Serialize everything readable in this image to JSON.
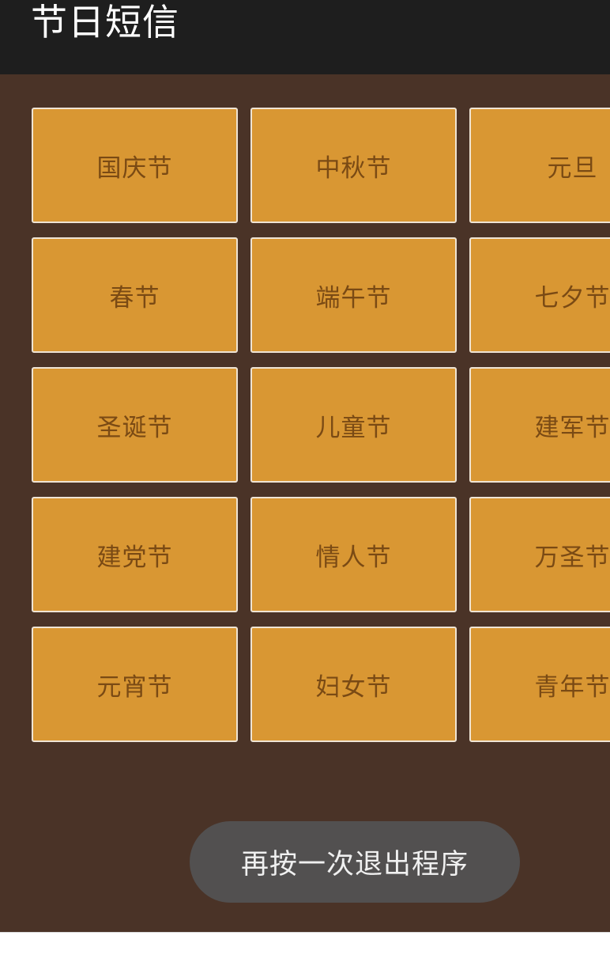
{
  "header": {
    "title": "节日短信"
  },
  "festivals": [
    "国庆节",
    "中秋节",
    "元旦",
    "春节",
    "端午节",
    "七夕节",
    "圣诞节",
    "儿童节",
    "建军节",
    "建党节",
    "情人节",
    "万圣节",
    "元宵节",
    "妇女节",
    "青年节"
  ],
  "toast": {
    "message": "再按一次退出程序"
  },
  "colors": {
    "background": "#4a3327",
    "header": "#1e1e1e",
    "tile": "#d99733",
    "tile_text": "#7a4a14",
    "toast": "#525050"
  }
}
